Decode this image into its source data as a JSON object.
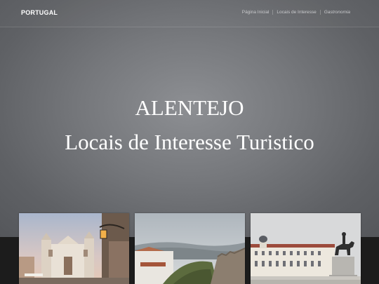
{
  "navbar": {
    "brand": "PORTUGAL",
    "links": [
      "Página Inicial",
      "Locais de Interesse",
      "Gastronomia"
    ]
  },
  "hero": {
    "title": "ALENTEJO",
    "subtitle": "Locais de Interesse Turistico"
  },
  "cards": [
    {
      "image": "evora-church-square-photo"
    },
    {
      "image": "marvao-castle-landscape-photo"
    },
    {
      "image": "vila-vicosa-palace-statue-photo"
    }
  ]
}
